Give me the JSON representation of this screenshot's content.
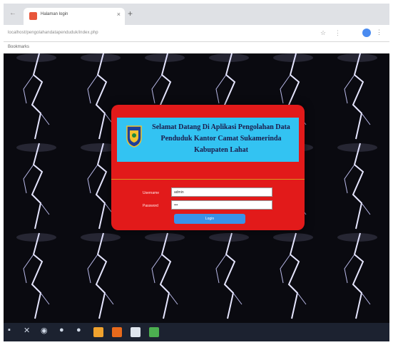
{
  "browser": {
    "tab_title": "Halaman login",
    "tab_close": "×",
    "new_tab": "+",
    "back": "←",
    "url": "localhost/pengolahandatapenduduk/index.php",
    "bookmarks_label": "Bookmarks",
    "star": "☆",
    "extensions": "⋮ ",
    "menu": "⋮"
  },
  "login": {
    "welcome_line1": "Selamat Datang Di Aplikasi Pengolahan Data",
    "welcome_line2": "Penduduk Kantor Camat Sukamerinda",
    "welcome_line3": "Kabupaten Lahat",
    "username_label": "Username",
    "username_value": "admin",
    "password_label": "Password",
    "password_value": "•••",
    "login_button": "Login"
  },
  "taskbar": {
    "items": [
      "windows-start",
      "search",
      "task-view",
      "chrome",
      "explorer",
      "xampp",
      "folder",
      "app"
    ]
  },
  "colors": {
    "card_red": "#e21a1a",
    "header_blue": "#33c3f2",
    "button_blue": "#3a92e8"
  }
}
